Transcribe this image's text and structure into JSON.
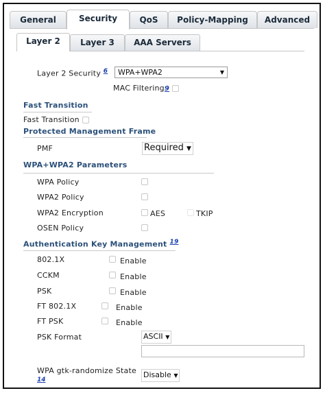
{
  "tabs": [
    "General",
    "Security",
    "QoS",
    "Policy-Mapping",
    "Advanced"
  ],
  "subtabs": [
    "Layer 2",
    "Layer 3",
    "AAA Servers"
  ],
  "layer2_security": {
    "label": "Layer 2 Security",
    "footnote": "6",
    "value": "WPA+WPA2"
  },
  "mac_filtering": {
    "label": "MAC Filtering",
    "footnote": "9"
  },
  "fast_transition": {
    "header": "Fast Transition",
    "label": "Fast Transition"
  },
  "pmf_section": {
    "header": "Protected Management Frame",
    "label": "PMF",
    "value": "Required"
  },
  "wpa_params": {
    "header": "WPA+WPA2 Parameters",
    "wpa_policy": "WPA Policy",
    "wpa2_policy": "WPA2 Policy",
    "wpa2_encryption": "WPA2 Encryption",
    "aes": "AES",
    "tkip": "TKIP",
    "osen_policy": "OSEN Policy"
  },
  "akm": {
    "header": "Authentication Key Management",
    "footnote": "19",
    "items": [
      {
        "label": "802.1X",
        "enable": "Enable"
      },
      {
        "label": "CCKM",
        "enable": "Enable"
      },
      {
        "label": "PSK",
        "enable": "Enable"
      },
      {
        "label": "FT 802.1X",
        "enable": "Enable"
      },
      {
        "label": "FT PSK",
        "enable": "Enable"
      }
    ],
    "psk_format": {
      "label": "PSK Format",
      "value": "ASCII"
    },
    "gtk": {
      "label": "WPA gtk-randomize State",
      "footnote": "14",
      "value": "Disable"
    }
  },
  "colors": {
    "section": "#2b5079",
    "link": "#1a3fb0",
    "tab_text": "#1b2a3a"
  }
}
